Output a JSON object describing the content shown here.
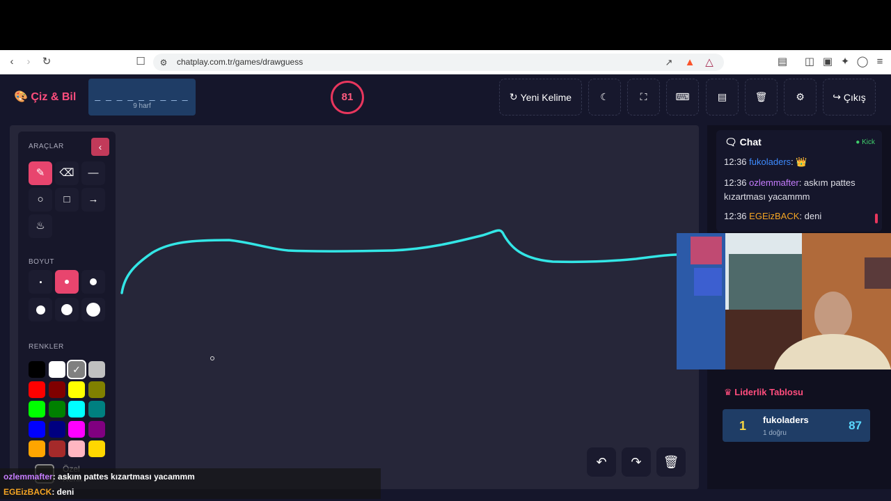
{
  "browser": {
    "url": "chatplay.com.tr/games/drawguess"
  },
  "header": {
    "logo": "Çiz & Bil",
    "word_pattern": "_ _ _ _ _ _ _ _ _",
    "word_length": "9 harf",
    "timer": "81",
    "buttons": {
      "new_word": "Yeni Kelime",
      "exit": "Çıkış"
    }
  },
  "tools": {
    "tools_title": "ARAÇLAR",
    "size_title": "BOYUT",
    "colors_title": "RENKLER",
    "custom_color": "Özel Renk",
    "colors": [
      "#000000",
      "#ffffff",
      "#808080",
      "#c0c0c0",
      "#ff0000",
      "#800000",
      "#ffff00",
      "#808000",
      "#00ff00",
      "#008000",
      "#00ffff",
      "#008080",
      "#0000ff",
      "#000080",
      "#ff00ff",
      "#800080",
      "#ffa500",
      "#a52a2a",
      "#ffb6c1",
      "#ffd700"
    ],
    "accent": "#e8456e"
  },
  "chat": {
    "title": "Chat",
    "platform": "Kick",
    "messages": [
      {
        "time": "12:36",
        "user": "fukoladers",
        "user_color": "#3d8bff",
        "text": ":"
      },
      {
        "time": "12:36",
        "user": "ozlemmafter",
        "user_color": "#c77dff",
        "text": ": askım pattes kızartması yacammm"
      },
      {
        "time": "12:36",
        "user": "EGEizBACK",
        "user_color": "#f5a524",
        "text": ": deni"
      }
    ]
  },
  "leaderboard": {
    "title": "Liderlik Tablosu",
    "entries": [
      {
        "rank": "1",
        "name": "fukoladers",
        "detail": "1 doğru",
        "score": "87"
      }
    ]
  },
  "overlay": {
    "lines": [
      {
        "user": "ozlemmafter",
        "user_color": "#c77dff",
        "text": ": askım pattes kızartması yacammm"
      },
      {
        "user": "EGEizBACK",
        "user_color": "#f5a524",
        "text": ": deni"
      }
    ]
  },
  "stroke_color": "#33e6e6"
}
